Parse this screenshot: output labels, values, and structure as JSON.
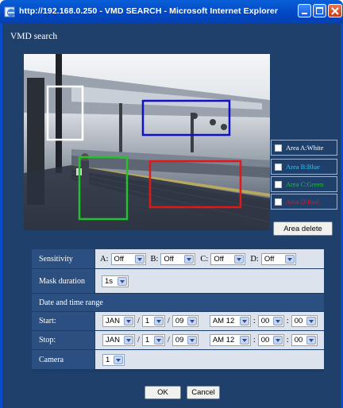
{
  "window": {
    "title": "http://192.168.0.250 - VMD SEARCH - Microsoft Internet Explorer",
    "icons": [
      "ie-icon",
      "minimize-icon",
      "maximize-icon",
      "close-icon"
    ],
    "titlebar_color": "#0a5fd8"
  },
  "page": {
    "heading": "VMD search"
  },
  "areas": [
    {
      "label": "Area A:White",
      "color": "#ffffff"
    },
    {
      "label": "Area B:Blue",
      "color": "#24c8ff"
    },
    {
      "label": "Area C:Green",
      "color": "#22c22a"
    },
    {
      "label": "Area D:Red",
      "color": "#e01818"
    }
  ],
  "area_delete_label": "Area delete",
  "form": {
    "sensitivity": {
      "label": "Sensitivity",
      "fields": [
        {
          "letter": "A:",
          "value": "Off"
        },
        {
          "letter": "B:",
          "value": "Off"
        },
        {
          "letter": "C:",
          "value": "Off"
        },
        {
          "letter": "D:",
          "value": "Off"
        }
      ]
    },
    "mask": {
      "label": "Mask duration",
      "value": "1s"
    },
    "date_section": "Date and time range",
    "start": {
      "label": "Start:",
      "month": "JAN",
      "day": "1",
      "year": "09",
      "hour": "AM 12",
      "minute": "00",
      "second": "00"
    },
    "stop": {
      "label": "Stop:",
      "month": "JAN",
      "day": "1",
      "year": "09",
      "hour": "AM 12",
      "minute": "00",
      "second": "00"
    },
    "camera": {
      "label": "Camera",
      "value": "1"
    },
    "slash": "/",
    "colon": ":"
  },
  "buttons": {
    "ok": "OK",
    "cancel": "Cancel"
  }
}
